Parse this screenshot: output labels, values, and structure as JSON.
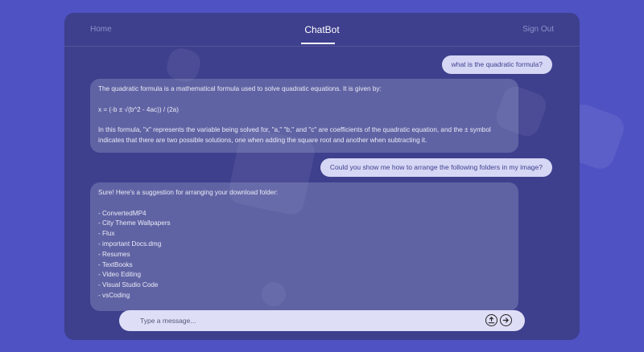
{
  "nav": {
    "home": "Home",
    "title": "ChatBot",
    "sign_out": "Sign Out"
  },
  "messages": [
    {
      "role": "user",
      "text": "what is the quadratic formula?"
    },
    {
      "role": "bot",
      "paragraphs": [
        "The quadratic formula is a mathematical formula used to solve quadratic equations. It is given by:",
        "x = (-b ± √(b^2 - 4ac)) / (2a)",
        "In this formula, \"x\" represents the variable being solved for, \"a,\" \"b,\" and \"c\" are coefficients of the quadratic equation, and the ± symbol indicates that there are two possible solutions, one when adding the square root and another when subtracting it."
      ]
    },
    {
      "role": "user",
      "text": "Could you show me how to arrange the following folders in my image?"
    },
    {
      "role": "bot",
      "intro": "Sure! Here's a suggestion for arranging your download folder:",
      "items": [
        "- ConvertedMP4",
        "- City Theme Wallpapers",
        "- Flux",
        "- important Docs.dmg",
        "- Resumes",
        "- TextBooks",
        "- Video Editing",
        "- Visual Studio Code",
        "- vsCoding"
      ]
    }
  ],
  "composer": {
    "placeholder": "Type a message...",
    "value": ""
  },
  "icons": {
    "upload": "upload-icon",
    "send": "send-arrow-icon"
  },
  "colors": {
    "page_bg": "#4f52c3",
    "panel_bg": "#3e3f8d",
    "user_bubble": "#d6d7f5",
    "bot_bubble": "#6a6da6",
    "composer_bg": "#dedff6"
  }
}
